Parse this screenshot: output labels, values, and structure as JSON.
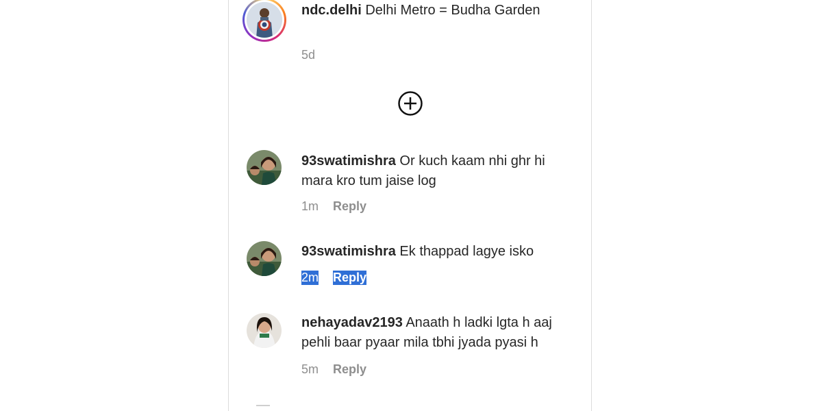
{
  "post": {
    "username": "ndc.delhi",
    "caption": "Delhi Metro = Budha Garden",
    "time": "5d"
  },
  "load_more_icon": "plus-circle-icon",
  "comments": [
    {
      "username": "93swatimishra",
      "text": "Or kuch kaam nhi ghr hi mara kro tum jaise log",
      "time": "1m",
      "reply_label": "Reply"
    },
    {
      "username": "93swatimishra",
      "text": "Ek thappad lagye isko",
      "time": "2m",
      "reply_label": "Reply",
      "highlighted": true
    },
    {
      "username": "nehayadav2193",
      "text": "Anaath h ladki lgta h aaj pehli baar pyaar mila tbhi jyada pyasi h",
      "time": "5m",
      "reply_label": "Reply"
    }
  ],
  "colors": {
    "text": "#262626",
    "meta": "#8e8e8e",
    "selection": "#2f6fd6",
    "border": "#dbdbdb"
  }
}
